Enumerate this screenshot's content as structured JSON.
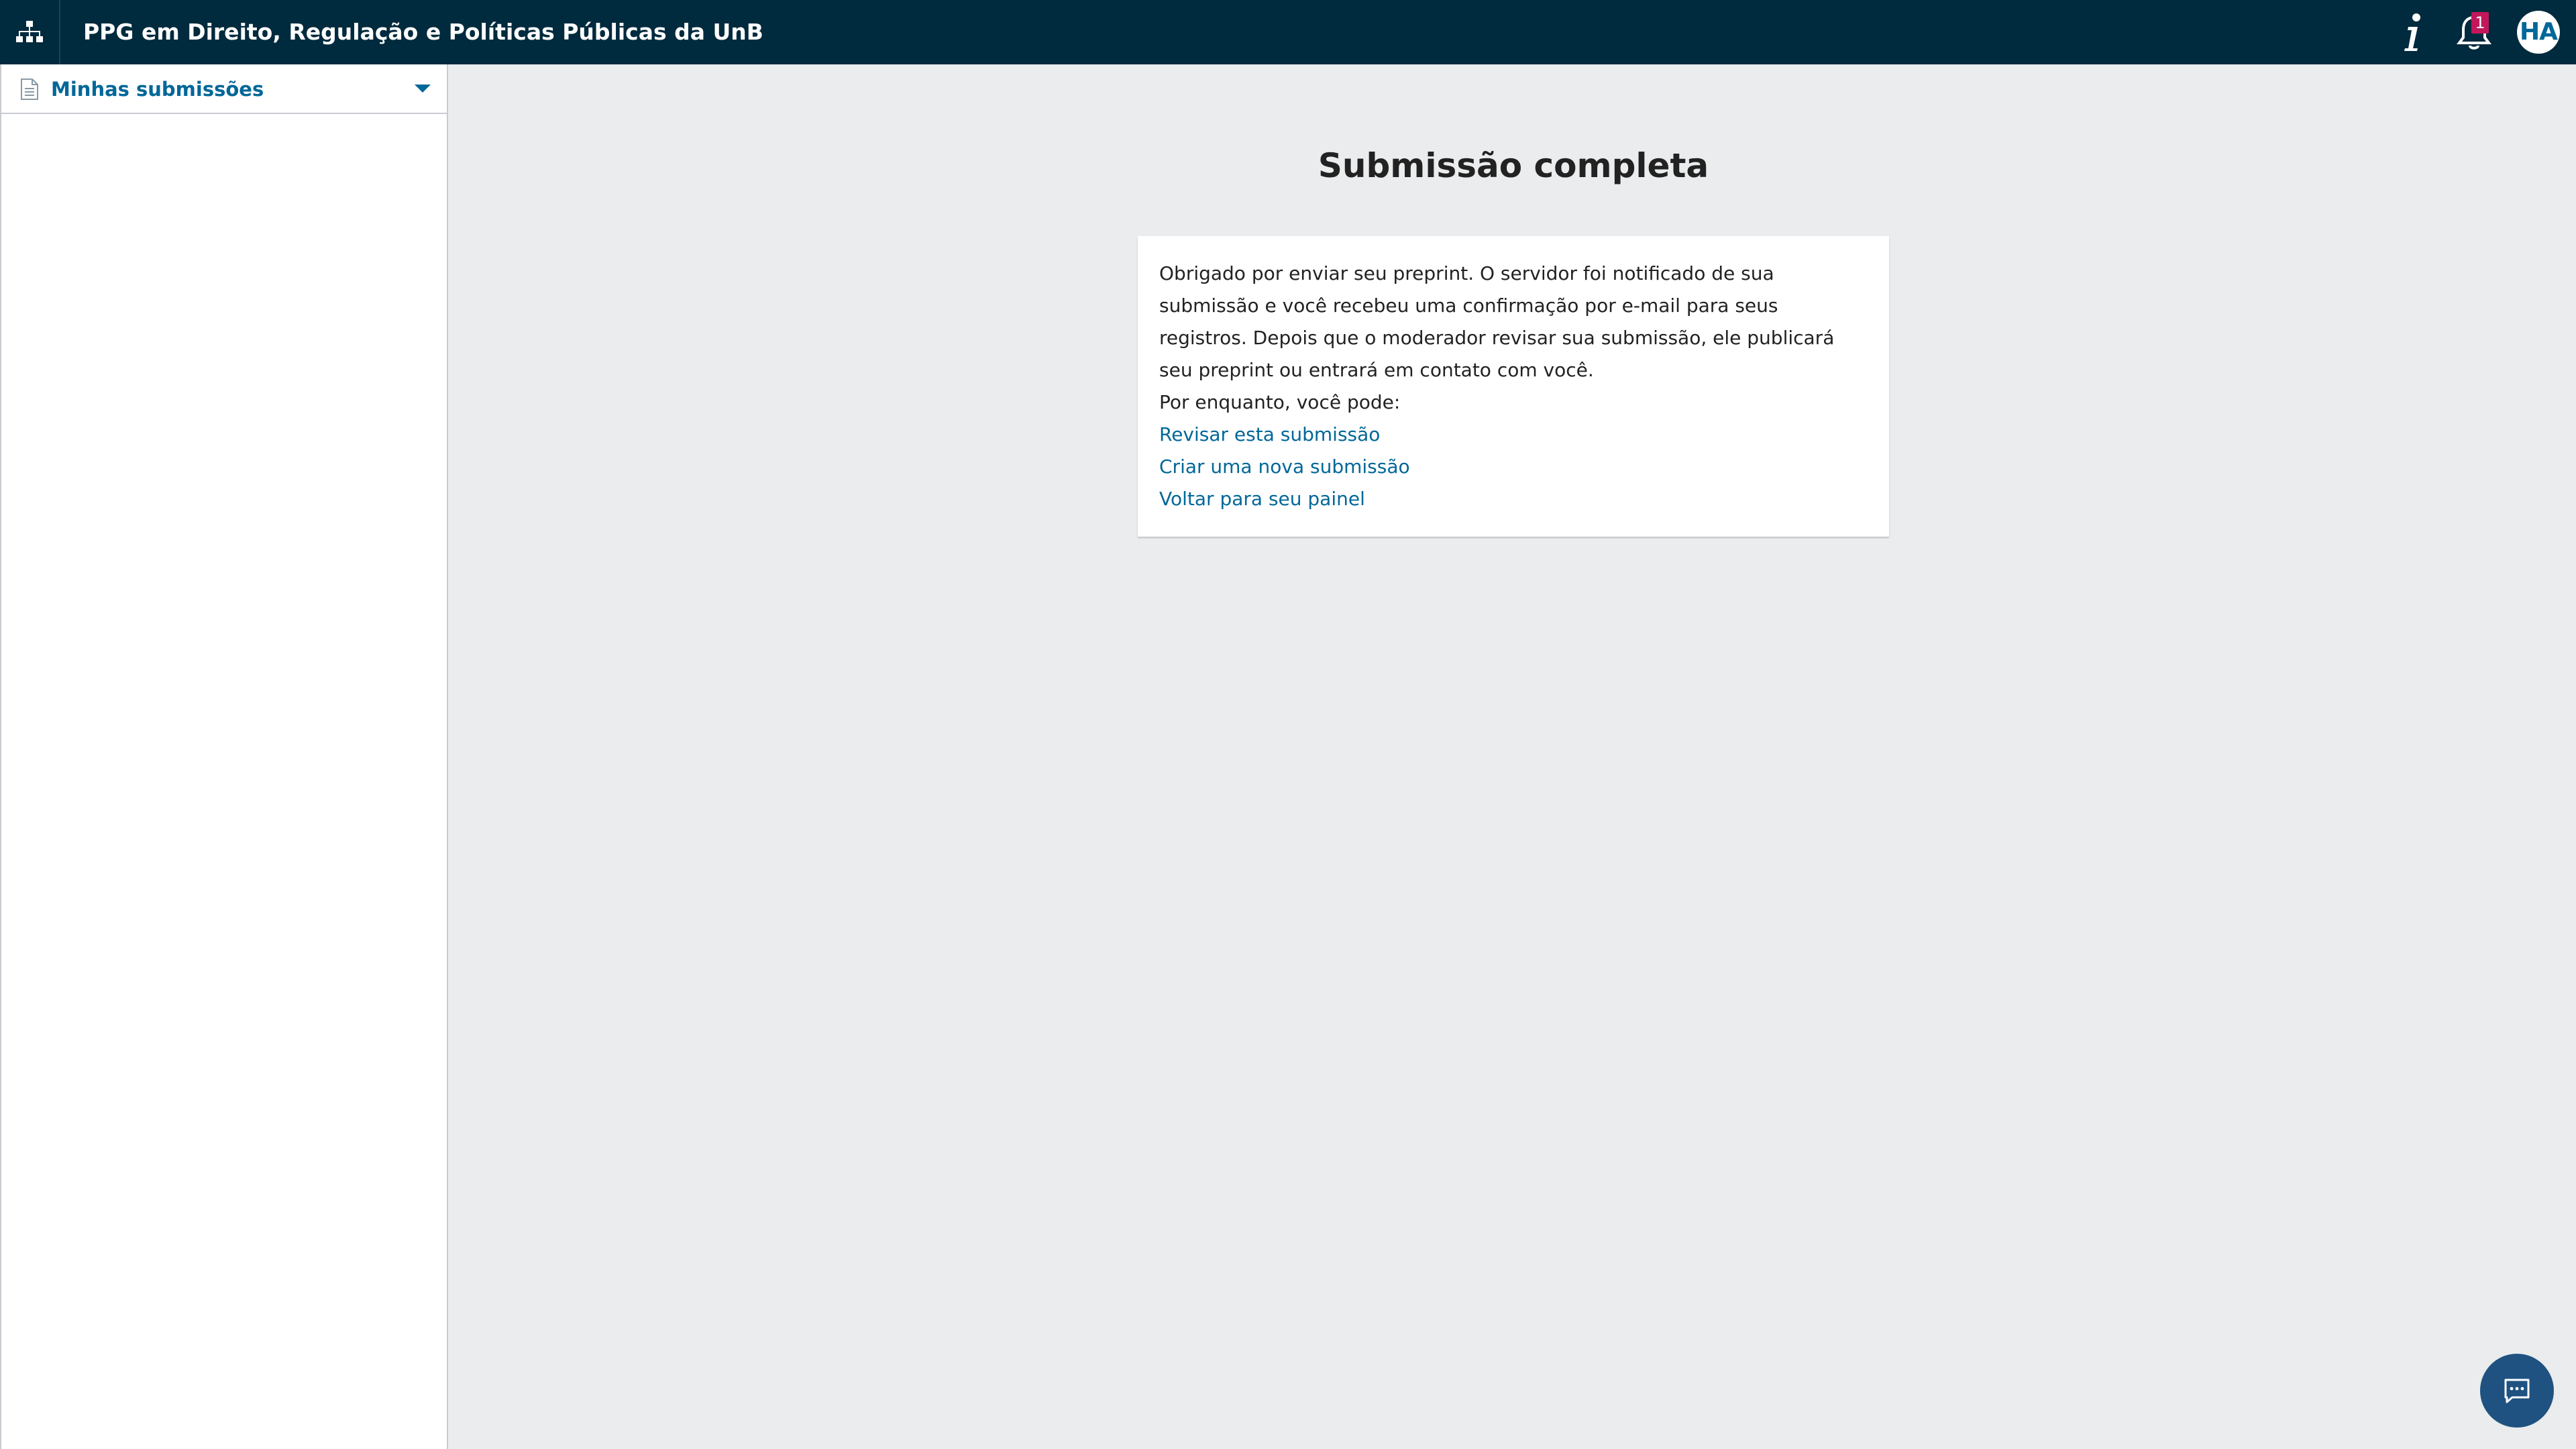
{
  "header": {
    "site_title": "PPG em Direito, Regulação e Políticas Públicas da UnB",
    "site_switch_icon": "sitemap-icon",
    "info_icon": "info-icon",
    "notifications_icon": "bell-icon",
    "notifications_count": "1",
    "avatar_initials": "HA",
    "background_color": "#002a3d"
  },
  "sidebar": {
    "items": [
      {
        "label": "Minhas submissões",
        "icon": "document-icon",
        "expand_icon": "chevron-down-icon"
      }
    ]
  },
  "main": {
    "title": "Submissão completa",
    "message": "Obrigado por enviar seu preprint. O servidor foi notificado de sua submissão e você recebeu uma confirmação por e-mail para seus registros. Depois que o moderador revisar sua submissão, ele publicará seu preprint ou entrará em contato com você.",
    "next_steps_intro": "Por enquanto, você pode:",
    "links": [
      "Revisar esta submissão",
      "Criar uma nova submissão",
      "Voltar para seu painel"
    ],
    "link_color": "#006798"
  },
  "chat": {
    "icon": "chat-icon"
  }
}
